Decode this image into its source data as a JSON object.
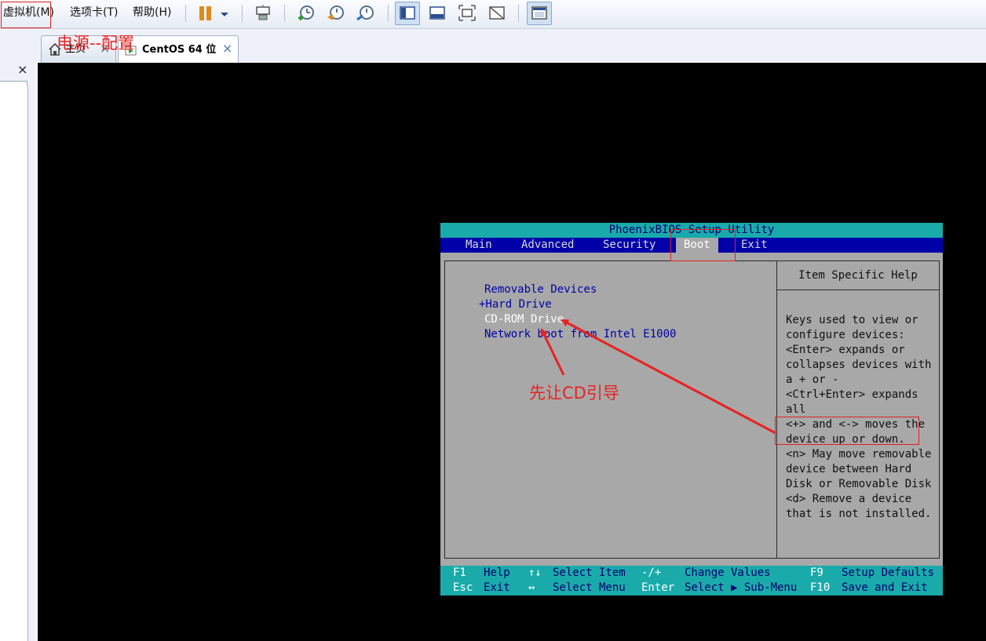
{
  "menu": {
    "vm": "虚拟机(M)",
    "tabs": "选项卡(T)",
    "help": "帮助(H)"
  },
  "toolbar": {
    "icons": [
      "pause-icon",
      "dropdown-icon",
      "send-keys-icon",
      "snapshot-take-icon",
      "snapshot-revert-icon",
      "snapshot-manager-icon",
      "view-library-icon",
      "view-console-icon",
      "fullscreen-icon",
      "unity-icon",
      "tabs-view-icon"
    ]
  },
  "left_panel": {
    "close": "×",
    "select_value": "..",
    "select_arrow": "▼"
  },
  "tabs": [
    {
      "label": "主页",
      "close": "×"
    },
    {
      "label": "CentOS 64 位",
      "close": "×"
    }
  ],
  "bios": {
    "title": "PhoenixBIOS Setup Utility",
    "menus": [
      "Main",
      "Advanced",
      "Security",
      "Boot",
      "Exit"
    ],
    "selected_menu": "Boot",
    "boot_items": [
      "Removable Devices",
      "+Hard Drive",
      "CD-ROM Drive",
      "Network boot from Intel E1000"
    ],
    "highlighted_item": "CD-ROM Drive",
    "help_title": "Item Specific Help",
    "help_lines": [
      "Keys used to view or",
      "configure devices:",
      "<Enter> expands or",
      "collapses devices with",
      "a + or -",
      "<Ctrl+Enter> expands",
      "all",
      "<+> and <-> moves the",
      "device up or down.",
      "<n> May move removable",
      "device between Hard",
      "Disk or Removable Disk",
      "<d> Remove a device",
      "that is not installed."
    ],
    "footer": {
      "row1": {
        "k1": "F1",
        "d1": "Help",
        "k2": "↑↓",
        "d2": "Select Item",
        "k3": "-/+",
        "d3": "Change Values",
        "k4": "F9",
        "d4": "Setup Defaults"
      },
      "row2": {
        "k1": "Esc",
        "d1": "Exit",
        "k2": "↔",
        "d2": "Select Menu",
        "k3": "Enter",
        "d3": "Select ▶ Sub-Menu",
        "k4": "F10",
        "d4": "Save and Exit"
      }
    }
  },
  "annotations": {
    "power_config": "电源--配置",
    "cd_first": "先让CD引导"
  },
  "colors": {
    "bios_cyan": "#1aaaaa",
    "bios_blue": "#0000a8",
    "bios_gray": "#a8a8a8",
    "annotation_red": "#e82222"
  }
}
